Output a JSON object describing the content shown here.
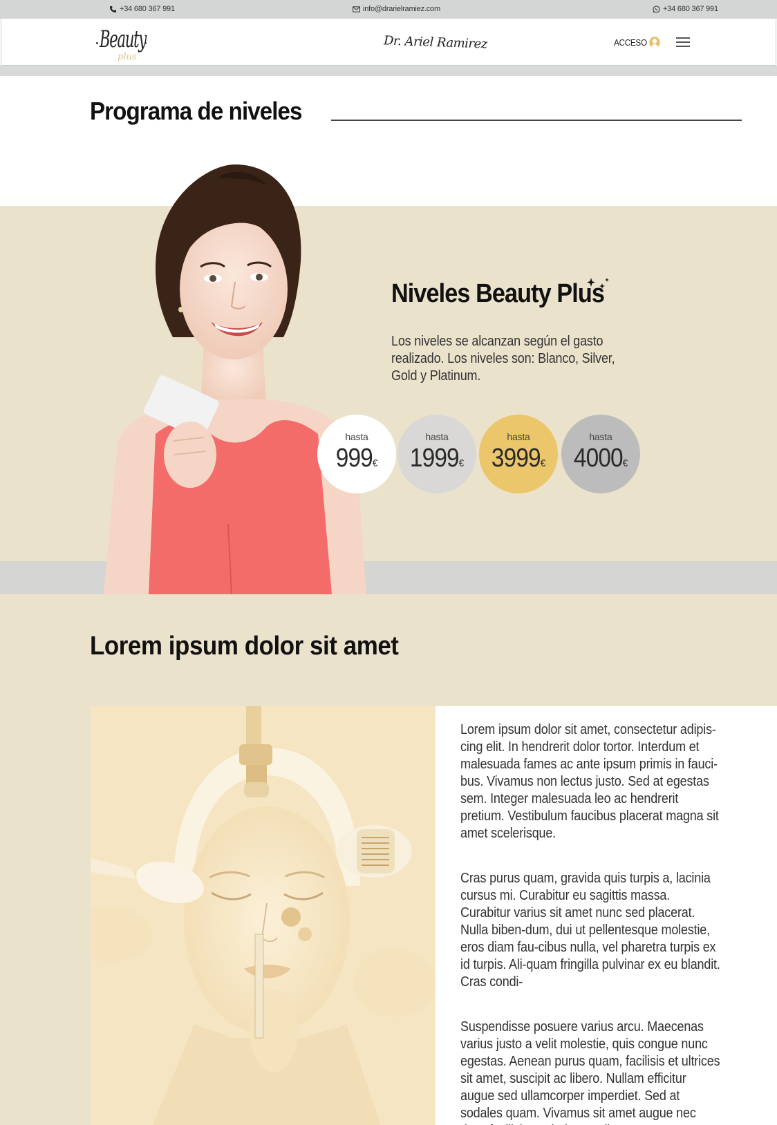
{
  "topbar": {
    "phone": "+34 680 367 991",
    "email": "info@drarielramiez.com",
    "whatsapp": "+34 680 367 991"
  },
  "header": {
    "logo_text": "Beauty",
    "logo_sub": "plus",
    "signature": "Dr. Ariel Ramirez",
    "access_label": "ACCESO"
  },
  "page": {
    "title": "Programa de niveles"
  },
  "niveles": {
    "title_light": "Niveles",
    "title_bold": "Beauty Plus",
    "description": "Los niveles se alcanzan según el gasto realizado. Los niveles son: Blanco, Silver, Gold y Platinum.",
    "levels": [
      {
        "prefix": "hasta",
        "amount": "999",
        "currency": "€",
        "color": "#ffffff"
      },
      {
        "prefix": "hasta",
        "amount": "1999",
        "currency": "€",
        "color": "#d9d8d6"
      },
      {
        "prefix": "hasta",
        "amount": "3999",
        "currency": "€",
        "color": "#ecc66a"
      },
      {
        "prefix": "hasta",
        "amount": "4000",
        "currency": "€",
        "color": "#bdbcbc"
      }
    ]
  },
  "lorem": {
    "title": "Lorem ipsum dolor sit amet",
    "paragraphs": [
      "Lorem ipsum dolor sit amet, consectetur adipis-cing elit. In hendrerit dolor tortor. Interdum et malesuada fames ac ante ipsum primis in fauci-bus. Vivamus non lectus justo. Sed at egestas sem. Integer malesuada leo ac hendrerit pretium. Vestibulum faucibus placerat magna sit amet scelerisque.",
      "Cras purus quam, gravida quis turpis a, lacinia cursus mi. Curabitur eu sagittis massa. Curabitur varius sit amet nunc sed placerat. Nulla biben-dum, dui ut pellentesque molestie, eros diam fau-cibus nulla, vel pharetra turpis ex id turpis. Ali-quam fringilla pulvinar ex eu blandit. Cras condi-",
      "Suspendisse posuere varius arcu. Maecenas varius justo a velit molestie, quis congue nunc egestas. Aenean purus quam, facilisis et ultrices sit amet, suscipit ac libero. Nullam efficitur augue sed ullamcorper imperdiet. Sed at sodales quam. Vivamus sit amet augue nec risus facilisis sagit-tis a et diam."
    ]
  },
  "colors": {
    "beige": "#ebe2cc",
    "gold": "#ecc66a",
    "gray_band": "#d5d5d3",
    "dress": "#f36c6a"
  },
  "icons": [
    "phone-icon",
    "mail-icon",
    "whatsapp-icon",
    "user-icon",
    "hamburger-menu-icon",
    "sparkles-icon"
  ]
}
